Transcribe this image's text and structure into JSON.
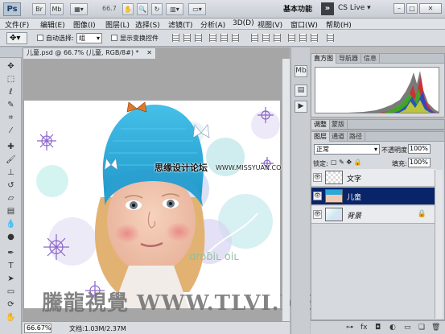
{
  "titlebar": {
    "app_icon": "Ps",
    "br_btn": "Br",
    "mb_btn": "Mb",
    "zoom": "66.7",
    "workspace": "基本功能",
    "cs_live": "CS Live"
  },
  "menu": [
    "文件(F)",
    "编辑(E)",
    "图像(I)",
    "图层(L)",
    "选择(S)",
    "滤镜(T)",
    "分析(A)",
    "3D(D)",
    "视图(V)",
    "窗口(W)",
    "帮助(H)"
  ],
  "options": {
    "auto_select_label": "自动选择:",
    "auto_select_value": "组",
    "show_transform_label": "显示变换控件"
  },
  "document": {
    "tab_title": "儿童.psd @ 66.7% (儿童, RGB/8#) *",
    "overlay_text": "思缘设计论坛",
    "overlay_url": "WWW.MISSYUAN.COM",
    "watermark": "騰龍視覺 WWW.TLVI.NET"
  },
  "status": {
    "zoom": "66.67%",
    "doc_size": "文档:1.03M/2.37M"
  },
  "panels": {
    "histogram_tabs": [
      "直方图",
      "导航器",
      "信息"
    ],
    "adjust_tabs": [
      "调整",
      "蒙版"
    ],
    "layer_tabs": [
      "图层",
      "通道",
      "路径"
    ],
    "blend_mode": "正常",
    "opacity_label": "不透明度:",
    "opacity_value": "100%",
    "lock_label": "锁定:",
    "fill_label": "填充:",
    "fill_value": "100%"
  },
  "layers": [
    {
      "name": "文字",
      "selected": false
    },
    {
      "name": "儿童",
      "selected": true
    },
    {
      "name": "背景",
      "selected": false,
      "locked": true
    }
  ],
  "colors": {
    "accent_selected_layer": "#0a246a",
    "hat": "#2ca8d6"
  }
}
